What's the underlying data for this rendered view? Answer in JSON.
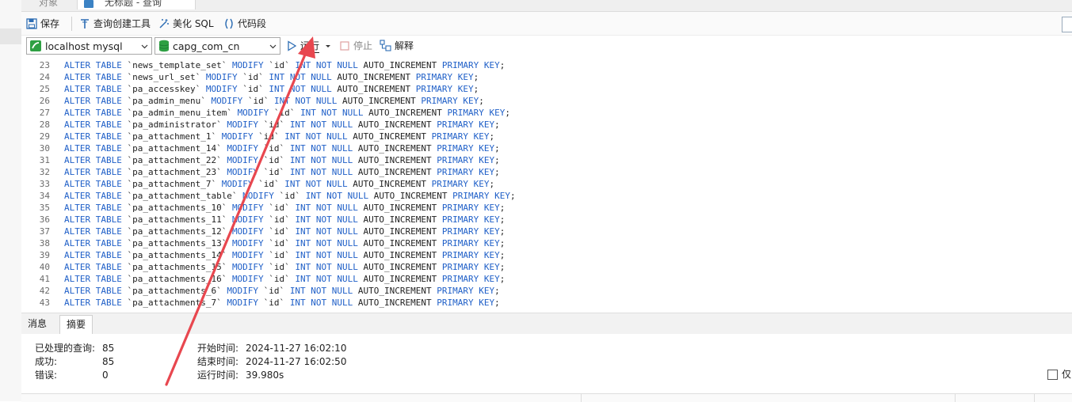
{
  "tabs": {
    "objects": "对象",
    "query": "无标题 - 查询"
  },
  "toolbar": {
    "save": "保存",
    "query_builder": "查询创建工具",
    "beautify": "美化 SQL",
    "snippet": "代码段"
  },
  "connection": {
    "server": "localhost mysql",
    "database": "capg_com_cn"
  },
  "actions": {
    "run": "运行",
    "stop": "停止",
    "explain": "解释"
  },
  "editor": {
    "lines": [
      {
        "n": "23",
        "p": "ALTER TABLE",
        "t": " `news_template_set` ",
        "m": "MODIFY",
        "c": " `id` ",
        "ty": "INT NOT NULL",
        "ai": " AUTO_INCREMENT ",
        "pk": "PRIMARY KEY",
        "e": ";"
      },
      {
        "n": "24",
        "p": "ALTER TABLE",
        "t": " `news_url_set` ",
        "m": "MODIFY",
        "c": " `id` ",
        "ty": "INT NOT NULL",
        "ai": " AUTO_INCREMENT ",
        "pk": "PRIMARY KEY",
        "e": ";"
      },
      {
        "n": "25",
        "p": "ALTER TABLE",
        "t": " `pa_accesskey` ",
        "m": "MODIFY",
        "c": " `id` ",
        "ty": "INT NOT NULL",
        "ai": " AUTO_INCREMENT ",
        "pk": "PRIMARY KEY",
        "e": ";"
      },
      {
        "n": "26",
        "p": "ALTER TABLE",
        "t": " `pa_admin_menu` ",
        "m": "MODIFY",
        "c": " `id` ",
        "ty": "INT NOT NULL",
        "ai": " AUTO_INCREMENT ",
        "pk": "PRIMARY KEY",
        "e": ";"
      },
      {
        "n": "27",
        "p": "ALTER TABLE",
        "t": " `pa_admin_menu_item` ",
        "m": "MODIFY",
        "c": " `id` ",
        "ty": "INT NOT NULL",
        "ai": " AUTO_INCREMENT ",
        "pk": "PRIMARY KEY",
        "e": ";"
      },
      {
        "n": "28",
        "p": "ALTER TABLE",
        "t": " `pa_administrator` ",
        "m": "MODIFY",
        "c": " `id` ",
        "ty": "INT NOT NULL",
        "ai": " AUTO_INCREMENT ",
        "pk": "PRIMARY KEY",
        "e": ";"
      },
      {
        "n": "29",
        "p": "ALTER TABLE",
        "t": " `pa_attachment_1` ",
        "m": "MODIFY",
        "c": " `id` ",
        "ty": "INT NOT NULL",
        "ai": " AUTO_INCREMENT ",
        "pk": "PRIMARY KEY",
        "e": ";"
      },
      {
        "n": "30",
        "p": "ALTER TABLE",
        "t": " `pa_attachment_14` ",
        "m": "MODIFY",
        "c": " `id` ",
        "ty": "INT NOT NULL",
        "ai": " AUTO_INCREMENT ",
        "pk": "PRIMARY KEY",
        "e": ";"
      },
      {
        "n": "31",
        "p": "ALTER TABLE",
        "t": " `pa_attachment_22` ",
        "m": "MODIFY",
        "c": " `id` ",
        "ty": "INT NOT NULL",
        "ai": " AUTO_INCREMENT ",
        "pk": "PRIMARY KEY",
        "e": ";"
      },
      {
        "n": "32",
        "p": "ALTER TABLE",
        "t": " `pa_attachment_23` ",
        "m": "MODIFY",
        "c": " `id` ",
        "ty": "INT NOT NULL",
        "ai": " AUTO_INCREMENT ",
        "pk": "PRIMARY KEY",
        "e": ";"
      },
      {
        "n": "33",
        "p": "ALTER TABLE",
        "t": " `pa_attachment_7` ",
        "m": "MODIFY",
        "c": " `id` ",
        "ty": "INT NOT NULL",
        "ai": " AUTO_INCREMENT ",
        "pk": "PRIMARY KEY",
        "e": ";"
      },
      {
        "n": "34",
        "p": "ALTER TABLE",
        "t": " `pa_attachment_table` ",
        "m": "MODIFY",
        "c": " `id` ",
        "ty": "INT NOT NULL",
        "ai": " AUTO_INCREMENT ",
        "pk": "PRIMARY KEY",
        "e": ";"
      },
      {
        "n": "35",
        "p": "ALTER TABLE",
        "t": " `pa_attachments_10` ",
        "m": "MODIFY",
        "c": " `id` ",
        "ty": "INT NOT NULL",
        "ai": " AUTO_INCREMENT ",
        "pk": "PRIMARY KEY",
        "e": ";"
      },
      {
        "n": "36",
        "p": "ALTER TABLE",
        "t": " `pa_attachments_11` ",
        "m": "MODIFY",
        "c": " `id` ",
        "ty": "INT NOT NULL",
        "ai": " AUTO_INCREMENT ",
        "pk": "PRIMARY KEY",
        "e": ";"
      },
      {
        "n": "37",
        "p": "ALTER TABLE",
        "t": " `pa_attachments_12` ",
        "m": "MODIFY",
        "c": " `id` ",
        "ty": "INT NOT NULL",
        "ai": " AUTO_INCREMENT ",
        "pk": "PRIMARY KEY",
        "e": ";"
      },
      {
        "n": "38",
        "p": "ALTER TABLE",
        "t": " `pa_attachments_13` ",
        "m": "MODIFY",
        "c": " `id` ",
        "ty": "INT NOT NULL",
        "ai": " AUTO_INCREMENT ",
        "pk": "PRIMARY KEY",
        "e": ";"
      },
      {
        "n": "39",
        "p": "ALTER TABLE",
        "t": " `pa_attachments_14` ",
        "m": "MODIFY",
        "c": " `id` ",
        "ty": "INT NOT NULL",
        "ai": " AUTO_INCREMENT ",
        "pk": "PRIMARY KEY",
        "e": ";"
      },
      {
        "n": "40",
        "p": "ALTER TABLE",
        "t": " `pa_attachments_15` ",
        "m": "MODIFY",
        "c": " `id` ",
        "ty": "INT NOT NULL",
        "ai": " AUTO_INCREMENT ",
        "pk": "PRIMARY KEY",
        "e": ";"
      },
      {
        "n": "41",
        "p": "ALTER TABLE",
        "t": " `pa_attachments_16` ",
        "m": "MODIFY",
        "c": " `id` ",
        "ty": "INT NOT NULL",
        "ai": " AUTO_INCREMENT ",
        "pk": "PRIMARY KEY",
        "e": ";"
      },
      {
        "n": "42",
        "p": "ALTER TABLE",
        "t": " `pa_attachments_6` ",
        "m": "MODIFY",
        "c": " `id` ",
        "ty": "INT NOT NULL",
        "ai": " AUTO_INCREMENT ",
        "pk": "PRIMARY KEY",
        "e": ";"
      },
      {
        "n": "43",
        "p": "ALTER TABLE",
        "t": " `pa_attachments_7` ",
        "m": "MODIFY",
        "c": " `id` ",
        "ty": "INT NOT NULL",
        "ai": " AUTO_INCREMENT ",
        "pk": "PRIMARY KEY",
        "e": ";"
      }
    ]
  },
  "result_tabs": {
    "messages": "消息",
    "summary": "摘要"
  },
  "summary": {
    "processed_label": "已处理的查询:",
    "processed_value": "85",
    "success_label": "成功:",
    "success_value": "85",
    "error_label": "错误:",
    "error_value": "0",
    "start_label": "开始时间:",
    "start_value": "2024-11-27 16:02:10",
    "end_label": "结束时间:",
    "end_value": "2024-11-27 16:02:50",
    "elapsed_label": "运行时间:",
    "elapsed_value": "39.980s"
  },
  "options": {
    "only_label": "仅"
  },
  "colors": {
    "keyword": "#2060c8",
    "annotation_arrow": "#e8474f",
    "db_icon": "#2ea043"
  }
}
